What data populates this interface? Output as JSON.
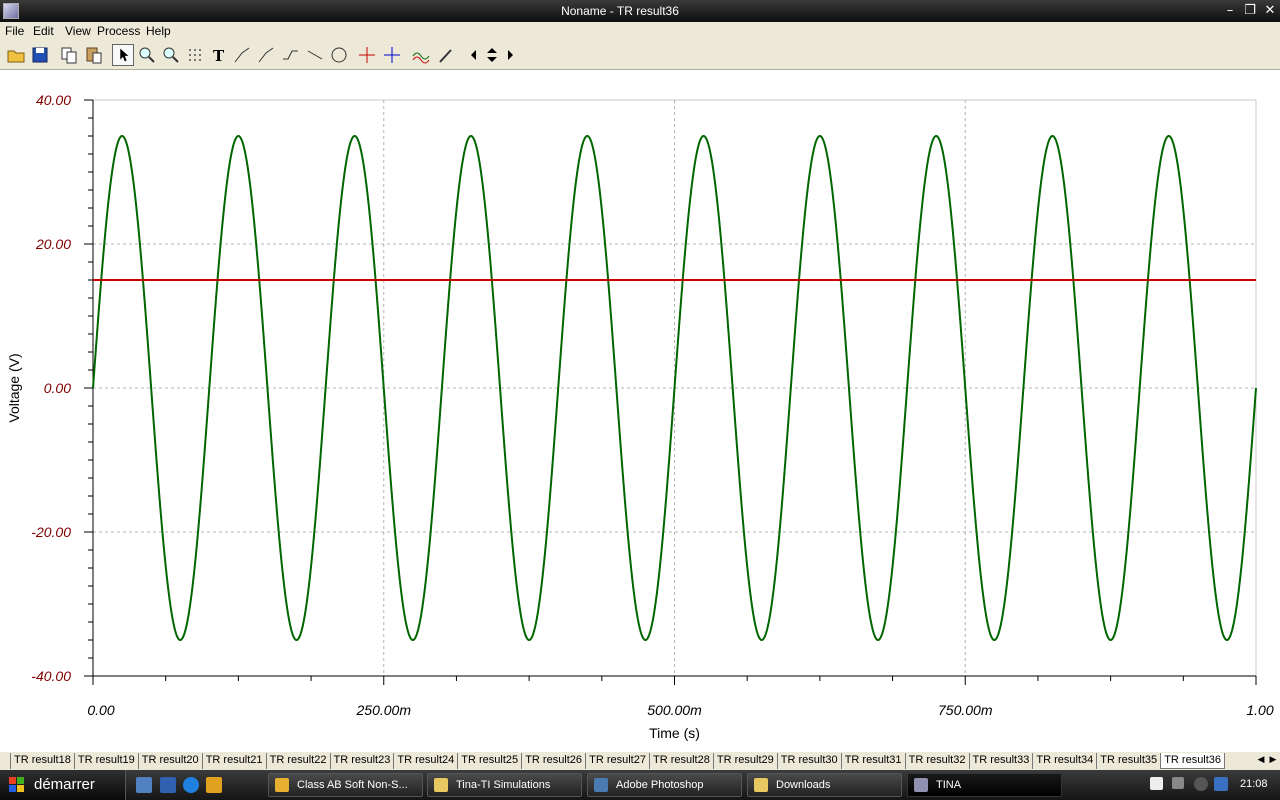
{
  "window": {
    "title": "Noname - TR result36"
  },
  "menu": [
    "File",
    "Edit",
    "View",
    "Process",
    "Help"
  ],
  "toolbar_icons": [
    "open-icon",
    "save-icon",
    "copy-icon",
    "paste-icon",
    "pointer-icon",
    "zoom-in-icon",
    "zoom-100-icon",
    "grid-icon",
    "text-icon",
    "curve-tool-icon",
    "curve-tool-2-icon",
    "curve-tool-3-icon",
    "line-icon",
    "circle-icon",
    "cursor-a-icon",
    "cursor-b-icon",
    "add-curve-icon",
    "probe-icon",
    "scroll-left-icon",
    "scroll-updown-icon",
    "scroll-right-icon"
  ],
  "chart_data": {
    "type": "line",
    "xlabel": "Time (s)",
    "ylabel": "Voltage (V)",
    "xlim": [
      0,
      1
    ],
    "ylim": [
      -40,
      40
    ],
    "x_ticks": [
      0,
      0.25,
      0.5,
      0.75,
      1.0
    ],
    "x_tick_labels": [
      "0.00",
      "250.00m",
      "500.00m",
      "750.00m",
      "1.00"
    ],
    "y_ticks": [
      40,
      20,
      0,
      -20,
      -40
    ],
    "y_tick_labels": [
      "40.00",
      "20.00",
      "0.00",
      "-20.00",
      "-40.00"
    ],
    "grid": true,
    "series": [
      {
        "color": "#006600",
        "function": "sine",
        "amplitude": 35,
        "frequency_hz": 10,
        "offset": 0
      },
      {
        "color": "#cc0000",
        "function": "constant",
        "value": 15
      }
    ]
  },
  "tabs": [
    "TR result18",
    "TR result19",
    "TR result20",
    "TR result21",
    "TR result22",
    "TR result23",
    "TR result24",
    "TR result25",
    "TR result26",
    "TR result27",
    "TR result28",
    "TR result29",
    "TR result30",
    "TR result31",
    "TR result32",
    "TR result33",
    "TR result34",
    "TR result35",
    "TR result36"
  ],
  "active_tab": "TR result36",
  "taskbar": {
    "start_label": "démarrer",
    "tasks": [
      {
        "label": "Class AB Soft Non-S...",
        "icon": "chrome-icon",
        "color": "#e8b030"
      },
      {
        "label": "Tina-TI Simulations",
        "icon": "folder-icon",
        "color": "#e8c860"
      },
      {
        "label": "Adobe Photoshop",
        "icon": "photoshop-icon",
        "color": "#4a7ab0"
      },
      {
        "label": "Downloads",
        "icon": "folder-icon",
        "color": "#e8c860"
      },
      {
        "label": "TINA",
        "icon": "tina-icon",
        "color": "#9090b0"
      }
    ],
    "clock": "21:08"
  }
}
